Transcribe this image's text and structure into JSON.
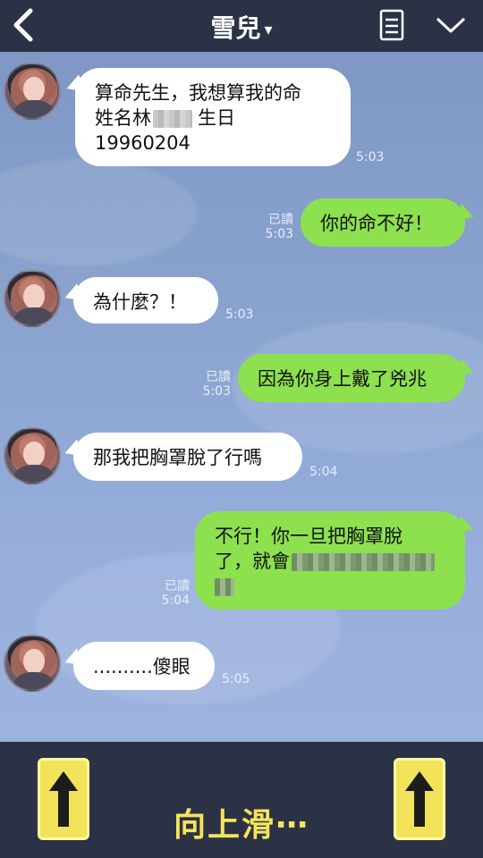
{
  "header": {
    "title": "雪兒",
    "caret": "▾",
    "icons": {
      "back": "back-chevron-icon",
      "note": "note-icon",
      "chevron": "chevron-down-icon"
    }
  },
  "messages": [
    {
      "direction": "in",
      "lines": [
        "算命先生，我想算我的命",
        "姓名林",
        "生日",
        "19960204"
      ],
      "time": "5:03"
    },
    {
      "direction": "out",
      "text": "你的命不好！",
      "read": "已讀",
      "time": "5:03"
    },
    {
      "direction": "in",
      "text": "為什麼？！",
      "time": "5:03"
    },
    {
      "direction": "out",
      "text": "因為你身上戴了兇兆",
      "read": "已讀",
      "time": "5:03"
    },
    {
      "direction": "in",
      "text": "那我把胸罩脫了行嗎",
      "time": "5:04"
    },
    {
      "direction": "out",
      "lines": [
        "不行！你一旦把胸罩脫",
        "了，就會"
      ],
      "read": "已讀",
      "time": "5:04"
    },
    {
      "direction": "in",
      "text": "..........傻眼",
      "time": "5:05"
    }
  ],
  "footer": {
    "swipe_text": "向上滑⋯",
    "left_icon": "up-arrow-icon",
    "right_icon": "up-arrow-icon"
  },
  "colors": {
    "header_bg": "#2b3246",
    "outgoing_bubble": "#8de04e",
    "incoming_bubble": "#ffffff",
    "swipe_text": "#f6e45a"
  }
}
